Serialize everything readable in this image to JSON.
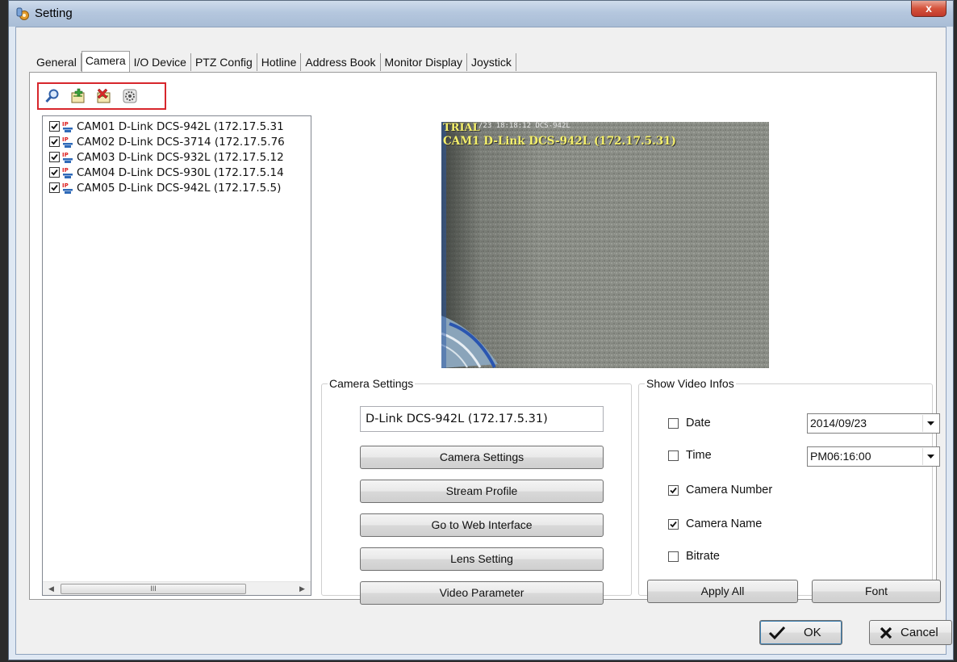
{
  "window": {
    "title": "Setting",
    "close_label": "x"
  },
  "tabs": [
    "General",
    "Camera",
    "I/O Device",
    "PTZ Config",
    "Hotline",
    "Address Book",
    "Monitor Display",
    "Joystick"
  ],
  "toolbar": {
    "icons": [
      "search-icon",
      "add-camera-icon",
      "delete-camera-icon",
      "settings-icon"
    ]
  },
  "camera_list": [
    {
      "label": "CAM01 D-Link DCS-942L (172.17.5.31",
      "checked": true
    },
    {
      "label": "CAM02 D-Link DCS-3714 (172.17.5.76",
      "checked": true
    },
    {
      "label": "CAM03 D-Link DCS-932L (172.17.5.12",
      "checked": true
    },
    {
      "label": "CAM04 D-Link DCS-930L (172.17.5.14",
      "checked": true
    },
    {
      "label": "CAM05 D-Link DCS-942L (172.17.5.5)",
      "checked": true
    }
  ],
  "scrollbar": {
    "grip": "III"
  },
  "preview": {
    "overlay_trial": "TRIAL",
    "overlay_datetime": "/23 18:18:12 DCS-942L",
    "overlay_camera": "CAM1 D-Link DCS-942L (172.17.5.31)"
  },
  "camera_settings": {
    "legend": "Camera Settings",
    "name_value": "D-Link DCS-942L (172.17.5.31)",
    "buttons": [
      "Camera Settings",
      "Stream Profile",
      "Go to Web Interface",
      "Lens Setting",
      "Video Parameter"
    ]
  },
  "video_infos": {
    "legend": "Show Video Infos",
    "options": [
      {
        "label": "Date",
        "checked": false
      },
      {
        "label": "Time",
        "checked": false
      },
      {
        "label": "Camera Number",
        "checked": true
      },
      {
        "label": "Camera Name",
        "checked": true
      },
      {
        "label": "Bitrate",
        "checked": false
      }
    ],
    "date_value": "2014/09/23",
    "time_value": "PM06:16:00",
    "apply_all_label": "Apply All",
    "font_label": "Font"
  },
  "footer": {
    "ok_label": "OK",
    "cancel_label": "Cancel"
  }
}
